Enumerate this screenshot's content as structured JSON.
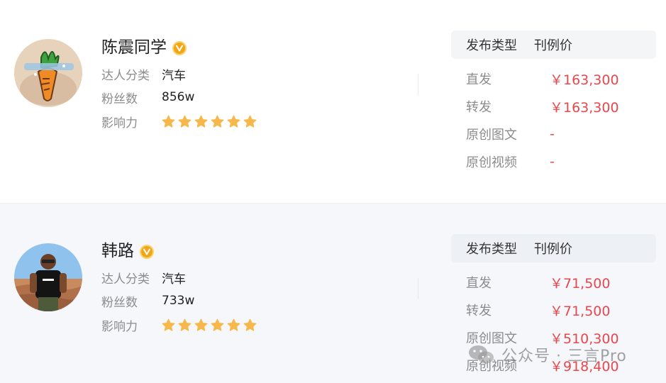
{
  "cards": [
    {
      "name": "陈震同学",
      "verified_badge": "V",
      "category_label": "达人分类",
      "category_value": "汽车",
      "fans_label": "粉丝数",
      "fans_value": "856w",
      "influence_label": "影响力",
      "influence_stars": 6,
      "price_header": {
        "type_label": "发布类型",
        "price_label": "刊例价"
      },
      "prices": [
        {
          "type": "直发",
          "value": "￥163,300"
        },
        {
          "type": "转发",
          "value": "￥163,300"
        },
        {
          "type": "原创图文",
          "value": "-"
        },
        {
          "type": "原创视频",
          "value": "-"
        }
      ]
    },
    {
      "name": "韩路",
      "verified_badge": "V",
      "category_label": "达人分类",
      "category_value": "汽车",
      "fans_label": "粉丝数",
      "fans_value": "733w",
      "influence_label": "影响力",
      "influence_stars": 6,
      "price_header": {
        "type_label": "发布类型",
        "price_label": "刊例价"
      },
      "prices": [
        {
          "type": "直发",
          "value": "￥71,500"
        },
        {
          "type": "转发",
          "value": "￥71,500"
        },
        {
          "type": "原创图文",
          "value": "￥510,300"
        },
        {
          "type": "原创视频",
          "value": "￥918,400"
        }
      ]
    }
  ],
  "watermark": {
    "text": "公众号 · 三言Pro",
    "icon": "wechat-icon"
  },
  "colors": {
    "price": "#e8474c",
    "star": "#f7b84b",
    "badge": "#f3a515",
    "label": "#8c8c8c"
  }
}
